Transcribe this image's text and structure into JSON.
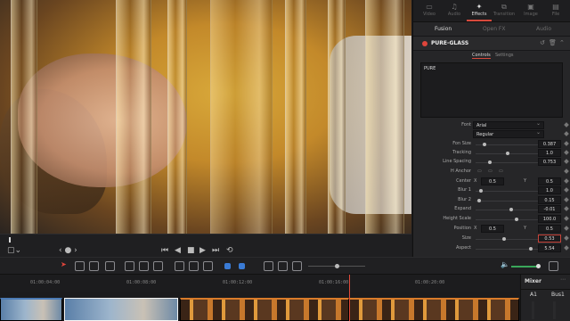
{
  "tabs": [
    {
      "label": "Video",
      "icon": "video-icon"
    },
    {
      "label": "Audio",
      "icon": "music-note-icon"
    },
    {
      "label": "Effects",
      "icon": "effects-icon"
    },
    {
      "label": "Transition",
      "icon": "transition-icon"
    },
    {
      "label": "Image",
      "icon": "image-icon"
    },
    {
      "label": "File",
      "icon": "file-icon"
    }
  ],
  "subtabs": [
    "Fusion",
    "Open FX",
    "Audio"
  ],
  "effect": {
    "name": "PURE-GLASS"
  },
  "control_tabs": [
    "Controls",
    "Settings"
  ],
  "text_content": "PURE",
  "params": {
    "font": {
      "label": "Font",
      "value": "Arial",
      "style": "Regular"
    },
    "font_size": {
      "label": "Fon Size",
      "value": "0.387"
    },
    "tracking": {
      "label": "Tracking",
      "value": "1.0"
    },
    "line_spacing": {
      "label": "Line Spacing",
      "value": "0.753"
    },
    "h_anchor": {
      "label": "H Anchor"
    },
    "center": {
      "label": "Center",
      "x_label": "X",
      "x": "0.5",
      "y_label": "Y",
      "y": "0.5"
    },
    "blur1": {
      "label": "Blur 1",
      "value": "1.0"
    },
    "blur2": {
      "label": "Blur 2",
      "value": "0.15"
    },
    "expand": {
      "label": "Expand",
      "value": "-0.01"
    },
    "height_scale": {
      "label": "Height Scale",
      "value": "100.0"
    },
    "position": {
      "label": "Position",
      "x_label": "X",
      "x": "0.5",
      "y_label": "Y",
      "y": "0.5"
    },
    "size": {
      "label": "Size",
      "value": "0.53"
    },
    "aspect": {
      "label": "Aspect",
      "value": "5.54"
    }
  },
  "timeline": {
    "timecodes": [
      "01:00:04:00",
      "01:00:08:00",
      "01:00:12:00",
      "01:00:16:00",
      "01:00:20:00"
    ]
  },
  "mixer": {
    "title": "Mixer",
    "ch1": "A1",
    "ch2": "Bus1"
  },
  "colors": {
    "accent": "#d7493c",
    "clip_blue": "#4c7bb5",
    "clip_orange": "#d97b2a"
  }
}
